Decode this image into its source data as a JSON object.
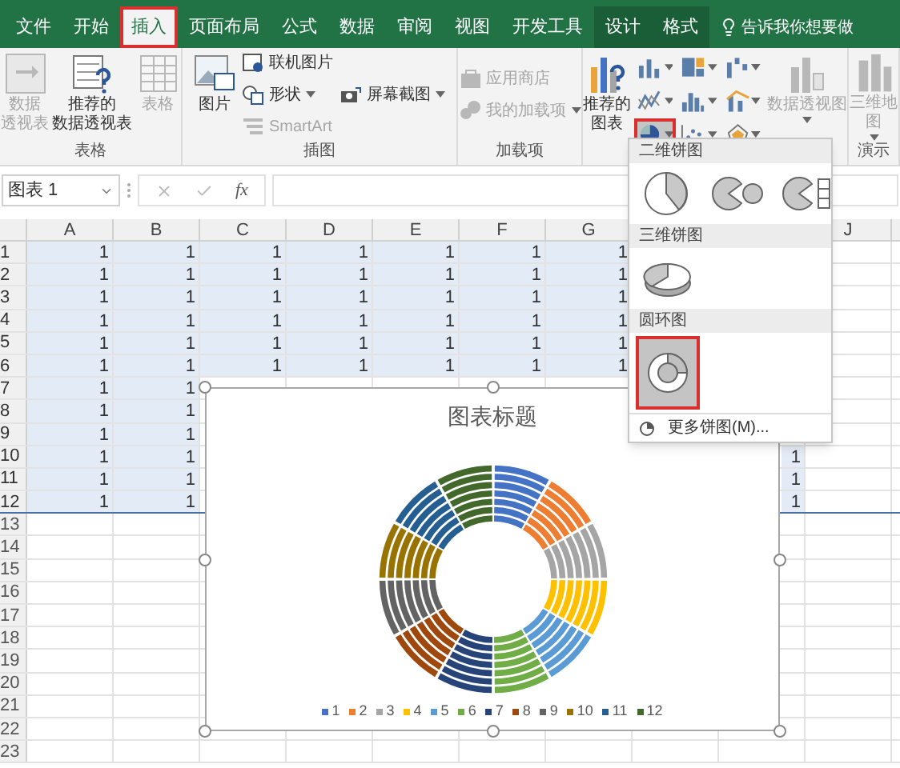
{
  "tabs": [
    {
      "label": "文件",
      "selected": false,
      "highlighted": false,
      "contextual": false
    },
    {
      "label": "开始",
      "selected": false,
      "highlighted": false,
      "contextual": false
    },
    {
      "label": "插入",
      "selected": true,
      "highlighted": true,
      "contextual": false
    },
    {
      "label": "页面布局",
      "selected": false,
      "highlighted": false,
      "contextual": false
    },
    {
      "label": "公式",
      "selected": false,
      "highlighted": false,
      "contextual": false
    },
    {
      "label": "数据",
      "selected": false,
      "highlighted": false,
      "contextual": false
    },
    {
      "label": "审阅",
      "selected": false,
      "highlighted": false,
      "contextual": false
    },
    {
      "label": "视图",
      "selected": false,
      "highlighted": false,
      "contextual": false
    },
    {
      "label": "开发工具",
      "selected": false,
      "highlighted": false,
      "contextual": false
    },
    {
      "label": "设计",
      "selected": false,
      "highlighted": false,
      "contextual": true
    },
    {
      "label": "格式",
      "selected": false,
      "highlighted": false,
      "contextual": true
    }
  ],
  "tell_me": "告诉我你想要做",
  "ribbon": {
    "groups": [
      {
        "label": "表格",
        "items": [
          {
            "kind": "large",
            "lines": [
              "数据",
              "透视表"
            ],
            "disabled": true,
            "caret": false
          },
          {
            "kind": "large",
            "lines": [
              "推荐的",
              "数据透视表"
            ],
            "disabled": false,
            "caret": false
          },
          {
            "kind": "large",
            "lines": [
              "表格"
            ],
            "disabled": true,
            "caret": false
          }
        ]
      },
      {
        "label": "插图",
        "items": [
          {
            "kind": "large",
            "lines": [
              "图片"
            ],
            "disabled": false,
            "caret": false
          },
          {
            "kind": "stack",
            "entries": [
              {
                "label": "联机图片",
                "disabled": false,
                "caret": false
              },
              {
                "label": "形状",
                "disabled": false,
                "caret": true
              },
              {
                "label": "SmartArt",
                "disabled": true,
                "caret": false
              }
            ]
          },
          {
            "kind": "stack",
            "entries": [
              {
                "label": "屏幕截图",
                "disabled": false,
                "caret": true
              }
            ]
          }
        ]
      },
      {
        "label": "加载项",
        "items": [
          {
            "kind": "stack",
            "entries": [
              {
                "label": "应用商店",
                "disabled": true,
                "caret": false
              },
              {
                "label": "我的加载项",
                "disabled": true,
                "caret": true
              }
            ]
          }
        ]
      },
      {
        "items": [
          {
            "kind": "large",
            "lines": [
              "推荐的",
              "图表"
            ],
            "disabled": false,
            "caret": false
          },
          {
            "kind": "chart_grid",
            "buttons": [
              {
                "selected": false,
                "highlighted": false
              },
              {
                "selected": false,
                "highlighted": false
              },
              {
                "selected": false,
                "highlighted": false
              },
              {
                "selected": false,
                "highlighted": false
              },
              {
                "selected": false,
                "highlighted": false
              },
              {
                "selected": false,
                "highlighted": false
              },
              {
                "selected": true,
                "highlighted": true
              },
              {
                "selected": false,
                "highlighted": false
              },
              {
                "selected": false,
                "highlighted": false
              }
            ]
          },
          {
            "kind": "large",
            "lines": [
              "数据透视图"
            ],
            "disabled": true,
            "caret": true
          }
        ]
      },
      {
        "label": "演示",
        "items": [
          {
            "kind": "large",
            "lines": [
              "三维地",
              "图"
            ],
            "disabled": true,
            "caret": true
          }
        ]
      }
    ]
  },
  "formula_bar": {
    "name_box": "图表 1",
    "function_label": "fx"
  },
  "sheet": {
    "columns": [
      "A",
      "B",
      "C",
      "D",
      "E",
      "F",
      "G",
      null,
      null,
      "J"
    ],
    "rows": [
      {
        "label": "1",
        "in_range": true,
        "values": [
          "1",
          "1",
          "1",
          "1",
          "1",
          "1",
          "1"
        ]
      },
      {
        "label": "2",
        "in_range": true,
        "values": [
          "1",
          "1",
          "1",
          "1",
          "1",
          "1",
          "1"
        ]
      },
      {
        "label": "3",
        "in_range": true,
        "values": [
          "1",
          "1",
          "1",
          "1",
          "1",
          "1",
          "1"
        ]
      },
      {
        "label": "4",
        "in_range": true,
        "values": [
          "1",
          "1",
          "1",
          "1",
          "1",
          "1",
          "1"
        ]
      },
      {
        "label": "5",
        "in_range": true,
        "values": [
          "1",
          "1",
          "1",
          "1",
          "1",
          "1",
          "1"
        ]
      },
      {
        "label": "6",
        "in_range": true,
        "values": [
          "1",
          "1",
          "1",
          "1",
          "1",
          "1",
          "1"
        ]
      },
      {
        "label": "7",
        "in_range": true,
        "values": [
          "1",
          "1"
        ]
      },
      {
        "label": "8",
        "in_range": true,
        "values": [
          "1",
          "1"
        ]
      },
      {
        "label": "9",
        "in_range": true,
        "values": [
          "1",
          "1"
        ]
      },
      {
        "label": "10",
        "in_range": true,
        "values": [
          "1",
          "1"
        ],
        "column_9": "1"
      },
      {
        "label": "11",
        "in_range": true,
        "values": [
          "1",
          "1"
        ],
        "column_9": "1"
      },
      {
        "label": "12",
        "in_range": true,
        "values": [
          "1",
          "1"
        ],
        "column_9": "1"
      },
      {
        "label": "13",
        "in_range": false
      },
      {
        "label": "14",
        "in_range": false
      },
      {
        "label": "15",
        "in_range": false
      },
      {
        "label": "16",
        "in_range": false
      },
      {
        "label": "17",
        "in_range": false
      },
      {
        "label": "18",
        "in_range": false
      },
      {
        "label": "19",
        "in_range": false
      },
      {
        "label": "20",
        "in_range": false
      },
      {
        "label": "21",
        "in_range": false
      },
      {
        "label": "22",
        "in_range": false
      },
      {
        "label": "23",
        "in_range": false
      }
    ]
  },
  "chart": {
    "title": "图表标题",
    "legend": [
      {
        "label": "1",
        "color": "#4472c4"
      },
      {
        "label": "2",
        "color": "#ed7d31"
      },
      {
        "label": "3",
        "color": "#a5a5a5"
      },
      {
        "label": "4",
        "color": "#ffc000"
      },
      {
        "label": "5",
        "color": "#5b9bd5"
      },
      {
        "label": "6",
        "color": "#70ad47"
      },
      {
        "label": "7",
        "color": "#264478"
      },
      {
        "label": "8",
        "color": "#9e480e"
      },
      {
        "label": "9",
        "color": "#636363"
      },
      {
        "label": "10",
        "color": "#997300"
      },
      {
        "label": "11",
        "color": "#255e91"
      },
      {
        "label": "12",
        "color": "#43682b"
      }
    ]
  },
  "pie_menu": {
    "sections": [
      {
        "title": "二维饼图",
        "options": [
          {
            "selected": false,
            "highlighted": false
          },
          {
            "selected": false,
            "highlighted": false
          },
          {
            "selected": false,
            "highlighted": false
          }
        ]
      },
      {
        "title": "三维饼图",
        "options": [
          {
            "selected": false,
            "highlighted": false
          }
        ]
      },
      {
        "title": "圆环图",
        "options": [
          {
            "selected": true,
            "highlighted": true
          }
        ]
      }
    ],
    "more": "更多饼图(M)..."
  }
}
